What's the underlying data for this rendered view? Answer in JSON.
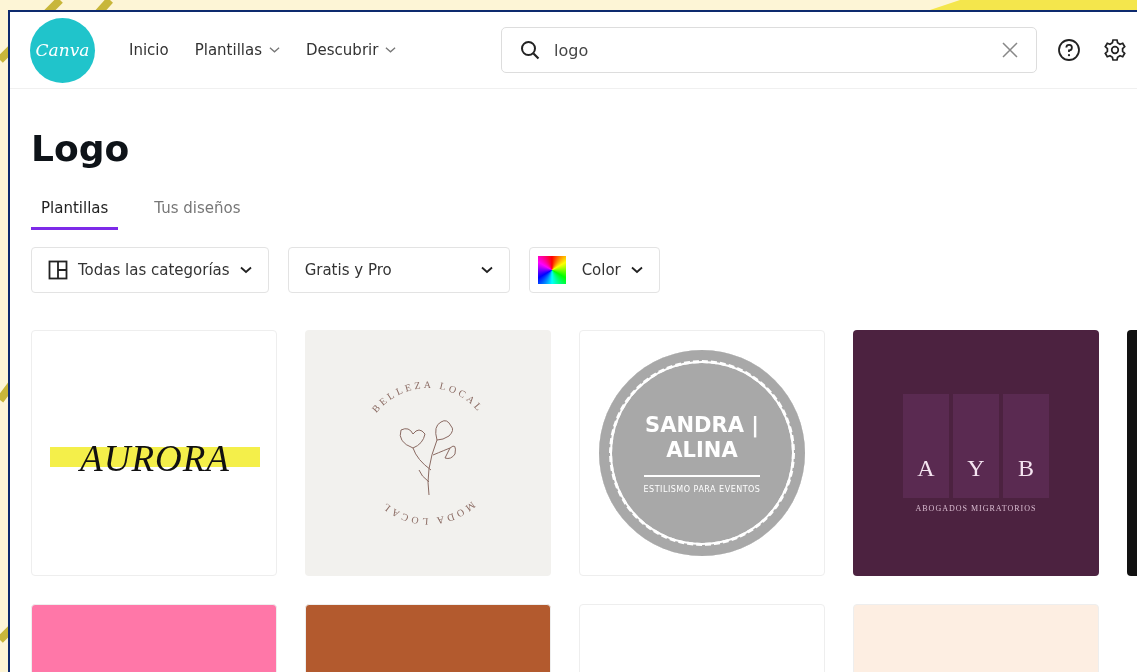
{
  "logo": {
    "text": "Canva"
  },
  "nav": {
    "links": [
      {
        "label": "Inicio",
        "dropdown": false
      },
      {
        "label": "Plantillas",
        "dropdown": true
      },
      {
        "label": "Descubrir",
        "dropdown": true
      }
    ]
  },
  "search": {
    "value": "logo"
  },
  "page_title": "Logo",
  "tabs": [
    {
      "label": "Plantillas",
      "selected": true
    },
    {
      "label": "Tus diseños",
      "selected": false
    }
  ],
  "filters": [
    {
      "kind": "category",
      "label": "Todas las categorías"
    },
    {
      "kind": "plain",
      "label": "Gratis y Pro"
    },
    {
      "kind": "color",
      "label": "Color"
    }
  ],
  "templates": [
    {
      "kind": "wordmark",
      "title": "AURORA"
    },
    {
      "kind": "circle-text",
      "top_text": "BELLEZA LOCAL",
      "bottom_text": "MODA LOCAL"
    },
    {
      "kind": "badge",
      "title": "SANDRA |",
      "title_2": "ALINA",
      "subtitle": "ESTILISMO PARA EVENTOS"
    },
    {
      "kind": "panels",
      "letters": [
        "A",
        "Y",
        "B"
      ],
      "subtitle": "ABOGADOS MIGRATORIOS"
    },
    {
      "kind": "dark"
    }
  ],
  "templates_row_2": [
    {
      "color": "#ff77a8"
    },
    {
      "color": "#b35a2e"
    },
    {
      "color": "#ffffff"
    },
    {
      "color": "#fdeee2"
    }
  ]
}
